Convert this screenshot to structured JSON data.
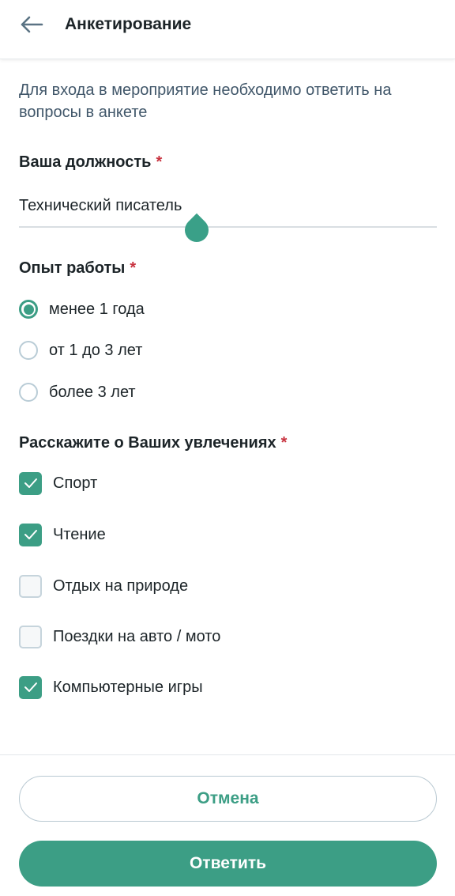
{
  "header": {
    "back_icon": "arrow-left-icon",
    "title": "Анкетирование"
  },
  "intro_text": "Для входа в мероприятие необходимо ответить на вопросы в анкете",
  "required_mark": "*",
  "colors": {
    "accent": "#3c9e85",
    "required": "#c8323f",
    "intro_text": "#41576a"
  },
  "q1": {
    "title": "Ваша должность",
    "value": "Технический писатель"
  },
  "q2": {
    "title": "Опыт работы",
    "options": [
      {
        "label": "менее 1 года",
        "selected": true
      },
      {
        "label": "от 1 до 3 лет",
        "selected": false
      },
      {
        "label": "более 3 лет",
        "selected": false
      }
    ]
  },
  "q3": {
    "title": "Расскажите о Ваших увлечениях",
    "options": [
      {
        "label": "Спорт",
        "checked": true
      },
      {
        "label": "Чтение",
        "checked": true
      },
      {
        "label": "Отдых на природе",
        "checked": false
      },
      {
        "label": "Поездки на авто / мото",
        "checked": false
      },
      {
        "label": "Компьютерные игры",
        "checked": true
      }
    ]
  },
  "footer": {
    "cancel_label": "Отмена",
    "submit_label": "Ответить"
  }
}
